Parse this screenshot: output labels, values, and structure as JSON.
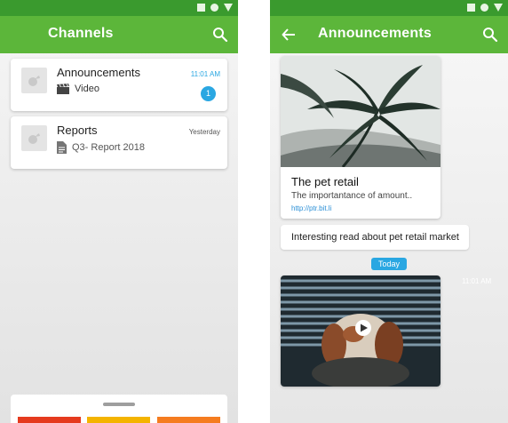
{
  "left_screen": {
    "title": "Channels",
    "channels": [
      {
        "name": "Announcements",
        "subtitle": "Video",
        "subtitle_icon": "clapperboard-icon",
        "time": "11:01 AM",
        "time_color": "#2aa7e2",
        "unread": "1"
      },
      {
        "name": "Reports",
        "subtitle": "Q3- Report 2018",
        "subtitle_icon": "document-icon",
        "time": "Yesterday",
        "time_color": "#555555"
      }
    ],
    "bottom_sheet": {
      "tile_colors": [
        "#e53a1e",
        "#f4b400",
        "#f57c1f"
      ]
    }
  },
  "right_screen": {
    "title": "Announcements",
    "link_card": {
      "title": "The pet retail",
      "description": "The importantance of amount..",
      "url": "http://ptr.bit.li"
    },
    "text_message": "Interesting read about pet retail market",
    "date_chip": "Today",
    "video_time": "11:01 AM"
  },
  "colors": {
    "status_bar": "#3a9a2e",
    "app_bar": "#5cb63a",
    "accent": "#2aa7e2"
  }
}
